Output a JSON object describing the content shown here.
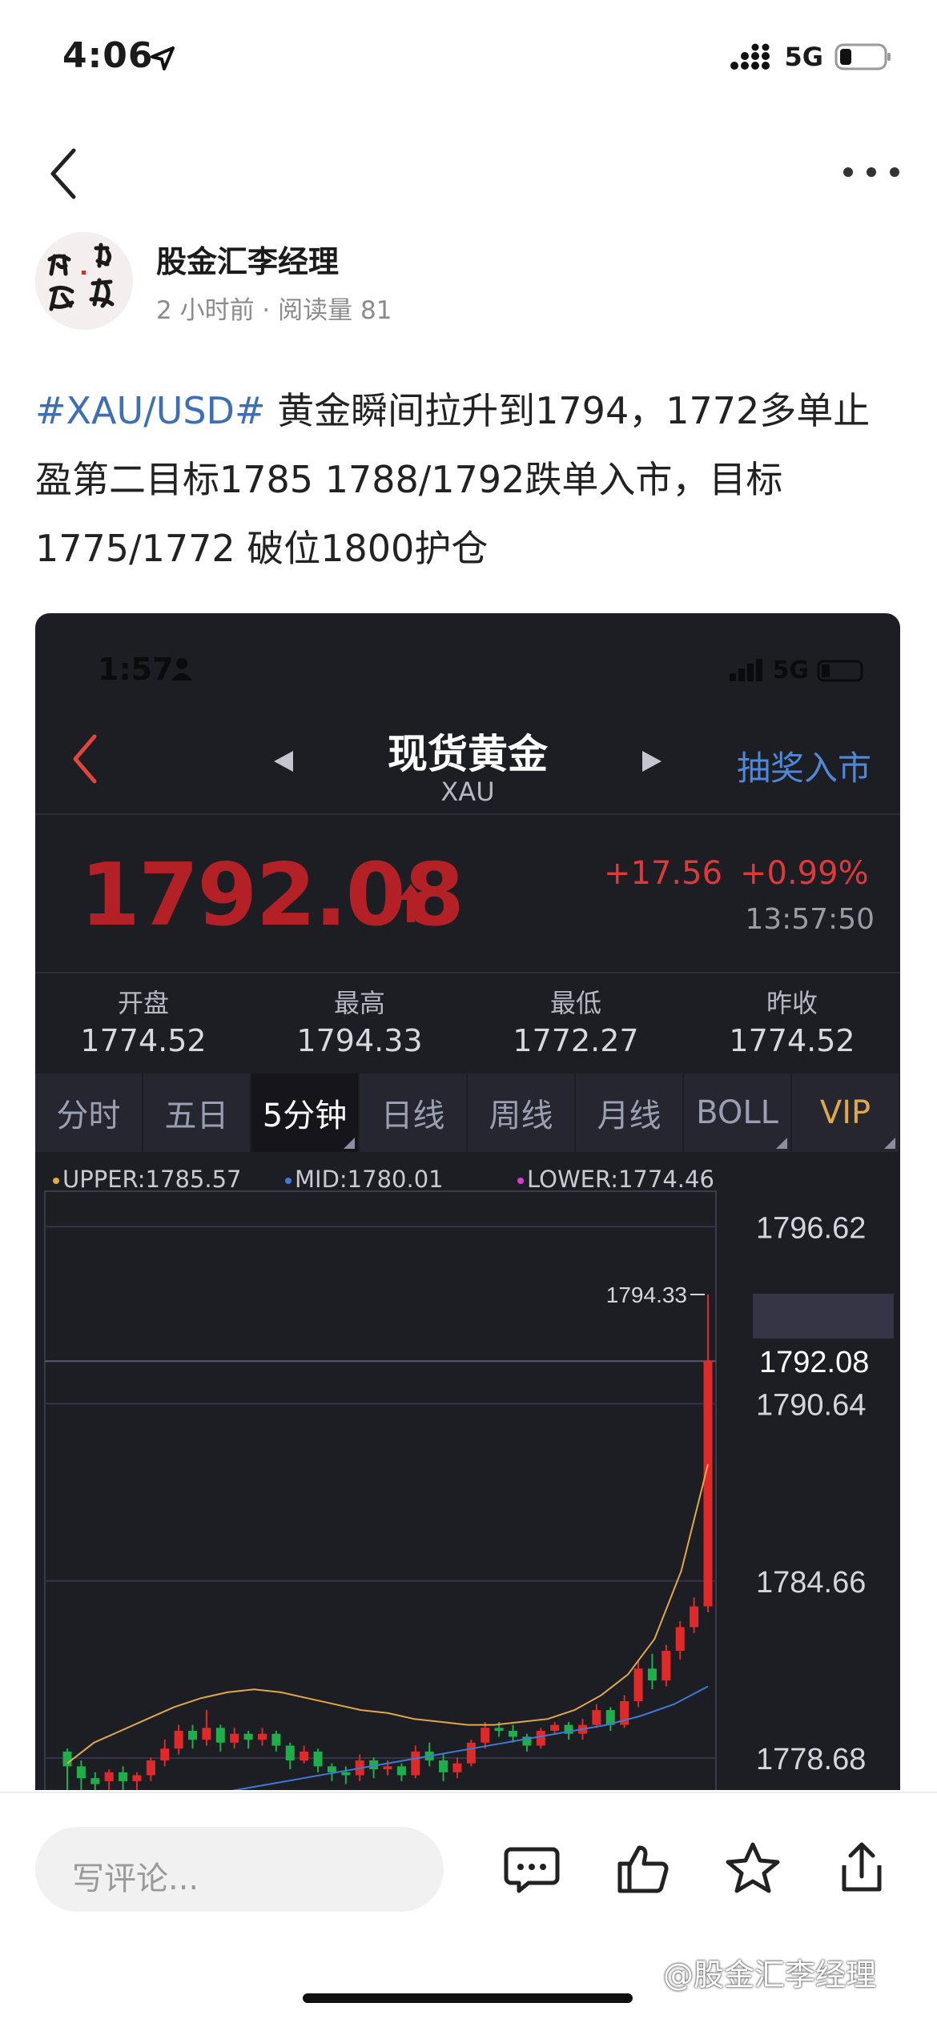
{
  "status_bar": {
    "time": "4:06",
    "network": "5G"
  },
  "author": {
    "name": "股金汇李经理",
    "meta": "2 小时前 · 阅读量 81"
  },
  "post": {
    "tag": "#XAU/USD#",
    "text": " 黄金瞬间拉升到1794，1772多单止盈第二目标1785 1788/1792跌单入市，目标1775/1772 破位1800护仓"
  },
  "screenshot": {
    "status_time": "1:57",
    "status_network": "5G",
    "title": "现货黄金",
    "subtitle": "XAU",
    "action": "抽奖入市",
    "price": "1792.08",
    "change": "+17.56",
    "change_pct": "+0.99%",
    "time": "13:57:50",
    "stats": [
      {
        "label": "开盘",
        "value": "1774.52"
      },
      {
        "label": "最高",
        "value": "1794.33"
      },
      {
        "label": "最低",
        "value": "1772.27"
      },
      {
        "label": "昨收",
        "value": "1774.52"
      }
    ],
    "tabs": [
      "分时",
      "五日",
      "5分钟",
      "日线",
      "周线",
      "月线",
      "BOLL",
      "VIP"
    ],
    "active_tab": "5分钟",
    "legend": {
      "upper": "UPPER:1785.57",
      "mid": "MID:1780.01",
      "lower": "LOWER:1774.46"
    },
    "colors": {
      "up": "#e02a2a",
      "down": "#1fae4a",
      "upper": "#e0a84a",
      "mid": "#3d7bd6",
      "lower": "#d83bd8"
    }
  },
  "chart_data": {
    "type": "candlestick",
    "ylim": [
      1777.6,
      1797.6
    ],
    "y_ticks": [
      1796.62,
      1790.64,
      1784.66,
      1778.68
    ],
    "current_price": 1792.08,
    "max_annotation": 1794.33,
    "candles": [
      [
        1778.9,
        1778.4,
        1779.0,
        1777.6
      ],
      [
        1778.4,
        1778.0,
        1778.6,
        1777.6
      ],
      [
        1778.0,
        1777.8,
        1778.2,
        1777.6
      ],
      [
        1777.9,
        1778.2,
        1778.3,
        1777.6
      ],
      [
        1778.2,
        1777.9,
        1778.4,
        1777.6
      ],
      [
        1777.9,
        1778.1,
        1778.2,
        1777.6
      ],
      [
        1778.1,
        1778.6,
        1778.7,
        1777.9
      ],
      [
        1778.6,
        1779.0,
        1779.3,
        1778.4
      ],
      [
        1779.0,
        1779.6,
        1779.8,
        1778.8
      ],
      [
        1779.6,
        1779.3,
        1779.8,
        1779.0
      ],
      [
        1779.3,
        1779.7,
        1780.3,
        1779.1
      ],
      [
        1779.7,
        1779.2,
        1779.8,
        1778.9
      ],
      [
        1779.2,
        1779.5,
        1779.7,
        1779.0
      ],
      [
        1779.5,
        1779.3,
        1779.6,
        1779.0
      ],
      [
        1779.3,
        1779.5,
        1779.7,
        1779.1
      ],
      [
        1779.5,
        1779.1,
        1779.6,
        1778.9
      ],
      [
        1779.1,
        1778.6,
        1779.2,
        1778.3
      ],
      [
        1778.6,
        1778.9,
        1779.1,
        1778.5
      ],
      [
        1778.9,
        1778.4,
        1779.0,
        1778.2
      ],
      [
        1778.4,
        1778.2,
        1778.5,
        1777.9
      ],
      [
        1778.2,
        1778.1,
        1778.4,
        1777.8
      ],
      [
        1778.1,
        1778.6,
        1778.8,
        1777.9
      ],
      [
        1778.6,
        1778.3,
        1778.7,
        1778.0
      ],
      [
        1778.3,
        1778.4,
        1778.6,
        1778.1
      ],
      [
        1778.4,
        1778.1,
        1778.5,
        1777.9
      ],
      [
        1778.1,
        1778.9,
        1779.1,
        1778.0
      ],
      [
        1778.9,
        1778.6,
        1779.2,
        1778.4
      ],
      [
        1778.6,
        1778.2,
        1778.8,
        1777.9
      ],
      [
        1778.2,
        1778.5,
        1778.7,
        1778.0
      ],
      [
        1778.5,
        1779.2,
        1779.3,
        1778.4
      ],
      [
        1779.2,
        1779.7,
        1779.9,
        1779.0
      ],
      [
        1779.7,
        1779.6,
        1779.9,
        1779.4
      ],
      [
        1779.6,
        1779.4,
        1779.8,
        1779.2
      ],
      [
        1779.4,
        1779.1,
        1779.5,
        1778.9
      ],
      [
        1779.1,
        1779.6,
        1779.7,
        1779.0
      ],
      [
        1779.6,
        1779.8,
        1779.9,
        1779.5
      ],
      [
        1779.8,
        1779.5,
        1779.9,
        1779.3
      ],
      [
        1779.5,
        1779.8,
        1780.0,
        1779.3
      ],
      [
        1779.8,
        1780.3,
        1780.5,
        1779.7
      ],
      [
        1780.3,
        1779.8,
        1780.4,
        1779.6
      ],
      [
        1779.8,
        1780.6,
        1780.8,
        1779.7
      ],
      [
        1780.6,
        1781.7,
        1782.0,
        1780.4
      ],
      [
        1781.7,
        1781.3,
        1782.2,
        1781.0
      ],
      [
        1781.3,
        1782.3,
        1782.5,
        1781.1
      ],
      [
        1782.3,
        1783.1,
        1783.3,
        1782.0
      ],
      [
        1783.1,
        1783.8,
        1784.1,
        1782.9
      ],
      [
        1783.8,
        1792.1,
        1794.33,
        1783.6
      ]
    ],
    "bands": {
      "upper": [
        1778.5,
        1779.2,
        1779.6,
        1780.0,
        1780.4,
        1780.7,
        1780.9,
        1781.0,
        1780.9,
        1780.7,
        1780.5,
        1780.3,
        1780.2,
        1780.0,
        1779.9,
        1779.8,
        1779.8,
        1779.9,
        1780.0,
        1780.3,
        1780.8,
        1781.5,
        1782.7,
        1785.0,
        1788.6
      ],
      "mid": [
        1776.0,
        1776.4,
        1776.8,
        1777.1,
        1777.4,
        1777.6,
        1777.8,
        1778.0,
        1778.2,
        1778.4,
        1778.6,
        1778.8,
        1779.0,
        1779.2,
        1779.4,
        1779.6,
        1779.8,
        1780.1,
        1780.5,
        1781.1
      ]
    }
  }
}
